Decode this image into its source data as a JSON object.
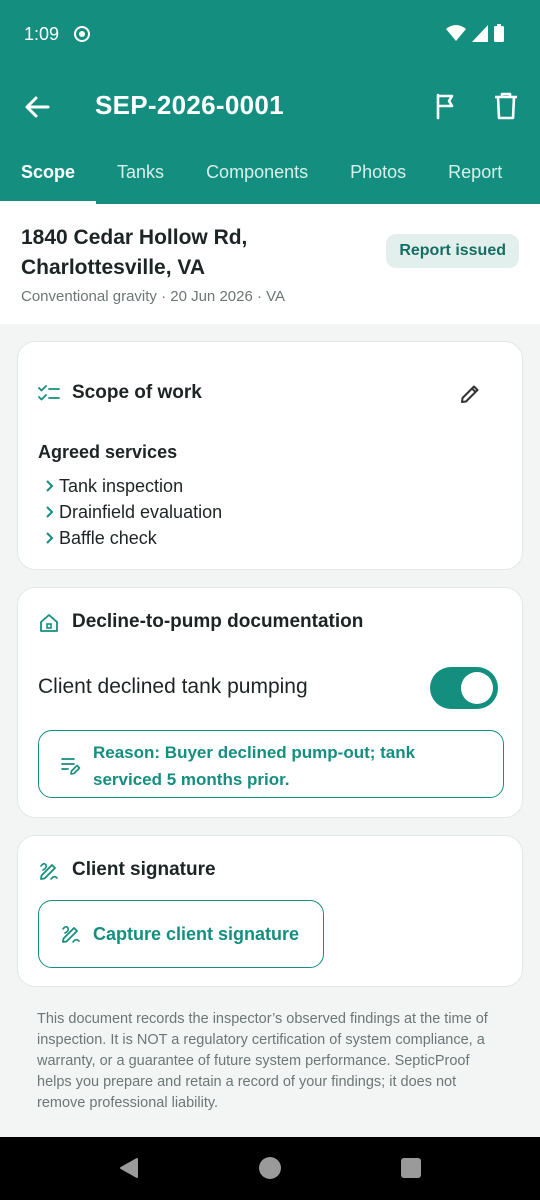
{
  "status_bar": {
    "time": "1:09"
  },
  "app_bar": {
    "title": "SEP-2026-0001"
  },
  "tabs": [
    {
      "label": "Scope",
      "active": true
    },
    {
      "label": "Tanks",
      "active": false
    },
    {
      "label": "Components",
      "active": false
    },
    {
      "label": "Photos",
      "active": false
    },
    {
      "label": "Report",
      "active": false
    }
  ],
  "job": {
    "address_line1": "1840 Cedar Hollow Rd,",
    "address_line2": "Charlottesville, VA",
    "meta": "Conventional gravity · 20 Jun 2026 · VA",
    "status_badge": "Report issued"
  },
  "scope_card": {
    "title": "Scope of work",
    "agreed_heading": "Agreed services",
    "services": [
      "Tank inspection",
      "Drainfield evaluation",
      "Baffle check"
    ]
  },
  "decline_card": {
    "title": "Decline-to-pump documentation",
    "toggle_label": "Client declined tank pumping",
    "toggle_on": true,
    "reason": "Reason: Buyer declined pump-out; tank serviced 5 months prior."
  },
  "signature_card": {
    "title": "Client signature",
    "button_label": "Capture client signature"
  },
  "disclaimer": "This document records the inspector’s observed findings at the time of inspection. It is NOT a regulatory certification of system compliance, a warranty, or a guarantee of future system performance. SepticProof helps you prepare and retain a record of your findings; it does not remove professional liability.",
  "colors": {
    "primary": "#148f7f",
    "badge_bg": "#e2efec",
    "badge_text": "#146e62",
    "background": "#f3f5f5"
  }
}
